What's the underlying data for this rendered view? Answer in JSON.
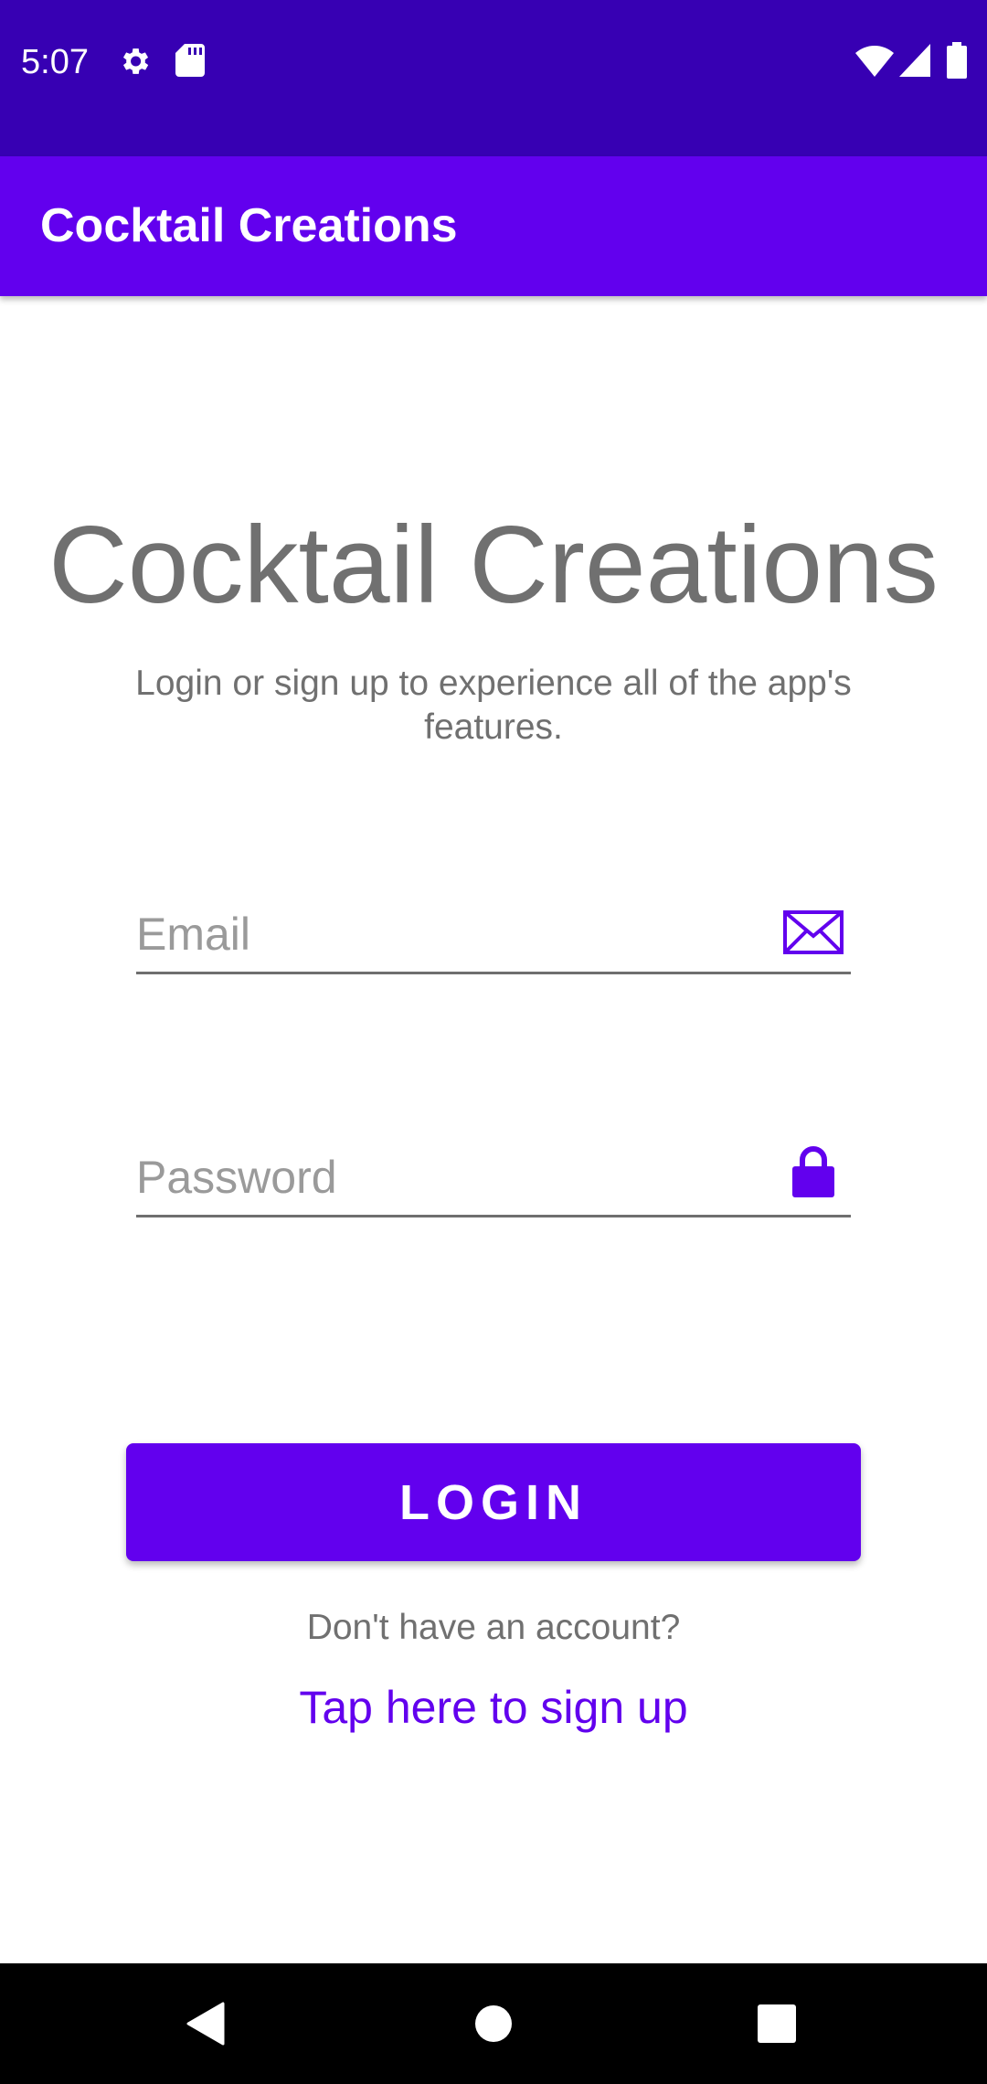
{
  "status_bar": {
    "time": "5:07",
    "icons": [
      "gear-icon",
      "sd-card-icon",
      "wifi-icon",
      "signal-icon",
      "battery-icon"
    ]
  },
  "app_bar": {
    "title": "Cocktail Creations"
  },
  "login": {
    "heading": "Cocktail Creations",
    "subtitle": "Login or sign up to experience all of the app's features.",
    "email_placeholder": "Email",
    "password_placeholder": "Password",
    "login_label": "LOGIN",
    "no_account_text": "Don't have an account?",
    "signup_link": "Tap here to sign up"
  },
  "nav_bar": {
    "buttons": [
      "back-icon",
      "home-icon",
      "recents-icon"
    ]
  },
  "colors": {
    "primary": "#6200EE",
    "primary_dark": "#3700B3",
    "text_secondary": "#707070"
  }
}
